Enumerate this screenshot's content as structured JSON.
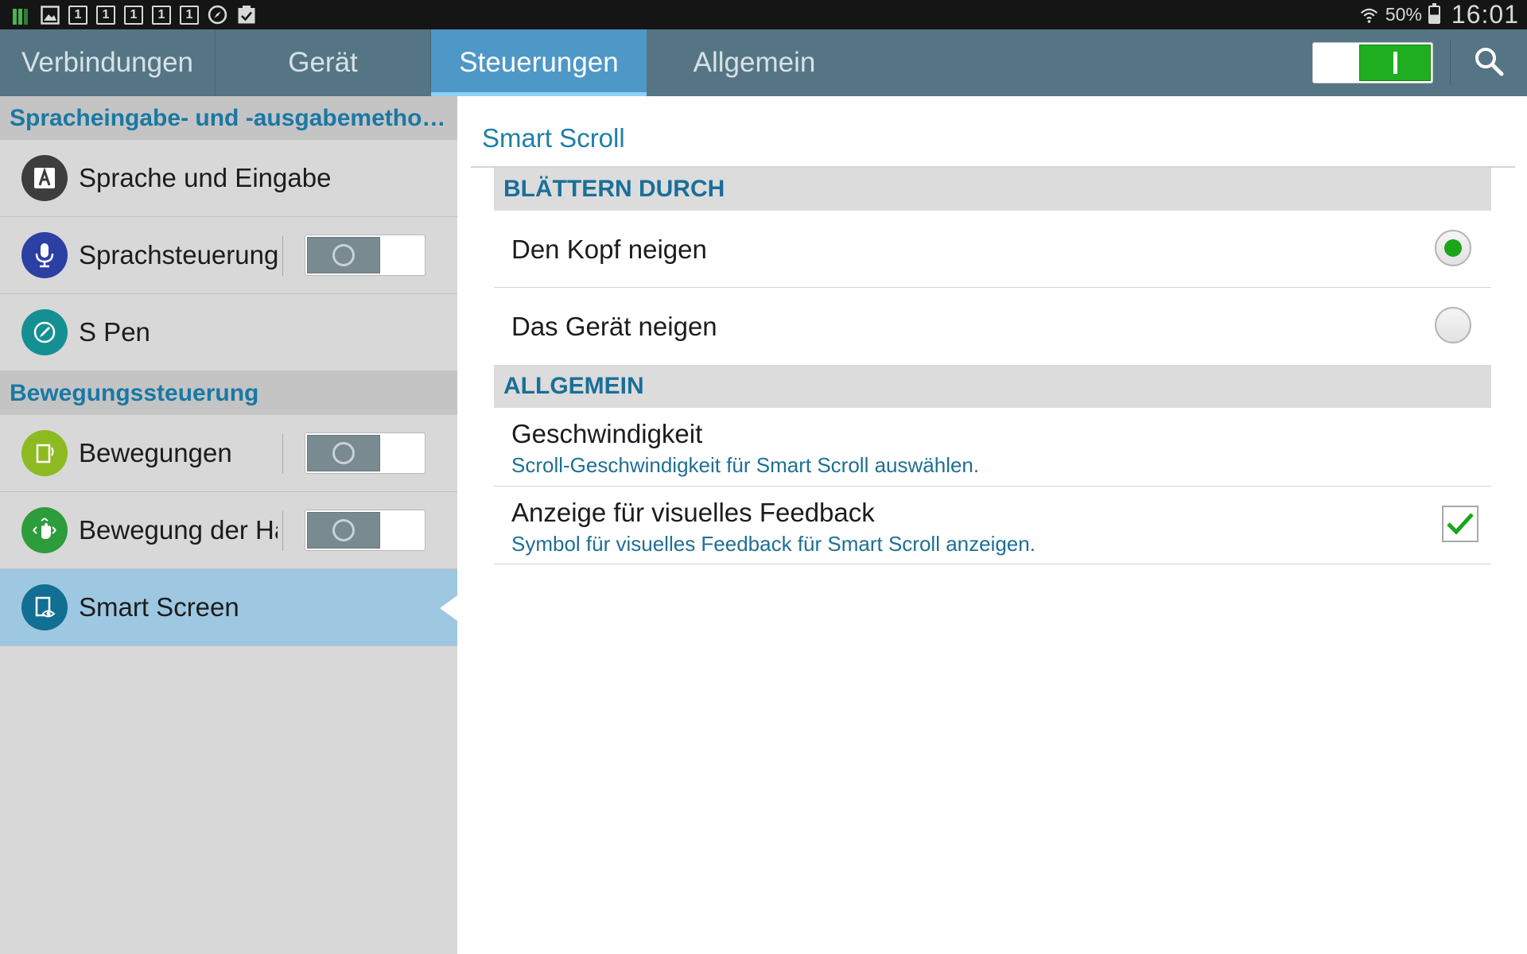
{
  "status_bar": {
    "notification_icons": [
      "signal-bars-icon",
      "image-icon",
      "sim-1-icon",
      "sim-1-icon",
      "sim-1-icon",
      "sim-1-icon",
      "sim-1-icon",
      "compass-icon",
      "clipboard-check-icon"
    ],
    "sim_label": "1",
    "battery_percent": "50%",
    "time": "16:01"
  },
  "tabs": {
    "items": [
      {
        "label": "Verbindungen",
        "active": false
      },
      {
        "label": "Gerät",
        "active": false
      },
      {
        "label": "Steuerungen",
        "active": true
      },
      {
        "label": "Allgemein",
        "active": false
      }
    ],
    "master_switch_on": true
  },
  "sidebar": {
    "section1": "Spracheingabe- und -ausgabemetho…",
    "section2": "Bewegungssteuerung",
    "items": [
      {
        "label": "Sprache und Eingabe",
        "icon": "language-a-icon",
        "color": "#3d3d3d",
        "toggle": null
      },
      {
        "label": "Sprachsteuerung",
        "icon": "microphone-icon",
        "color": "#2c3fa2",
        "toggle": false
      },
      {
        "label": "S Pen",
        "icon": "pen-icon",
        "color": "#159092",
        "toggle": null
      },
      {
        "label": "Bewegungen",
        "icon": "device-motion-icon",
        "color": "#8dba21",
        "toggle": false
      },
      {
        "label": "Bewegung der Hand",
        "icon": "hand-motion-icon",
        "color": "#2d9c3a",
        "toggle": false
      },
      {
        "label": "Smart Screen",
        "icon": "smart-screen-eye-icon",
        "color": "#106f92",
        "toggle": null,
        "selected": true
      }
    ]
  },
  "main": {
    "title": "Smart Scroll",
    "section_scroll": "BLÄTTERN DURCH",
    "option_head": "Den Kopf neigen",
    "option_device": "Das Gerät neigen",
    "selected_option": "Den Kopf neigen",
    "section_general": "ALLGEMEIN",
    "speed_label": "Geschwindigkeit",
    "speed_sub": "Scroll-Geschwindigkeit für Smart Scroll auswählen.",
    "feedback_label": "Anzeige für visuelles Feedback",
    "feedback_sub": "Symbol für visuelles Feedback für Smart Scroll anzeigen.",
    "feedback_checked": true
  },
  "colors": {
    "tab_bar": "#567584",
    "tab_active": "#4e98c7",
    "accent_text": "#1a78a4",
    "switch_on": "#1fae1f",
    "sidebar_bg": "#d8d8d8",
    "sidebar_selected": "#9ec7e2"
  }
}
